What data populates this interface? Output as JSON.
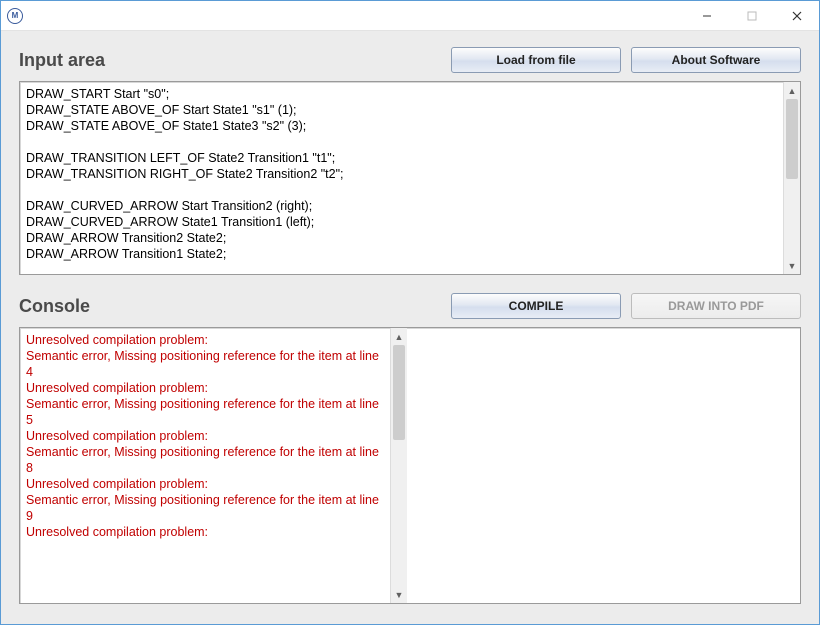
{
  "titlebar": {
    "app_icon_letter": "M"
  },
  "input": {
    "title": "Input area",
    "buttons": {
      "load": "Load from file",
      "about": "About Software"
    },
    "text": "DRAW_START Start \"s0\";\nDRAW_STATE ABOVE_OF Start State1 \"s1\" (1);\nDRAW_STATE ABOVE_OF State1 State3 \"s2\" (3);\n\nDRAW_TRANSITION LEFT_OF State2 Transition1 \"t1\";\nDRAW_TRANSITION RIGHT_OF State2 Transition2 \"t2\";\n\nDRAW_CURVED_ARROW Start Transition2 (right);\nDRAW_CURVED_ARROW State1 Transition1 (left);\nDRAW_ARROW Transition2 State2;\nDRAW_ARROW Transition1 State2;"
  },
  "console": {
    "title": "Console",
    "buttons": {
      "compile": "COMPILE",
      "draw": "DRAW INTO PDF"
    },
    "text": "Unresolved compilation problem:\nSemantic error, Missing positioning reference for the item at line 4\nUnresolved compilation problem:\nSemantic error, Missing positioning reference for the item at line 5\nUnresolved compilation problem:\nSemantic error, Missing positioning reference for the item at line 8\nUnresolved compilation problem:\nSemantic error, Missing positioning reference for the item at line 9\nUnresolved compilation problem:"
  }
}
